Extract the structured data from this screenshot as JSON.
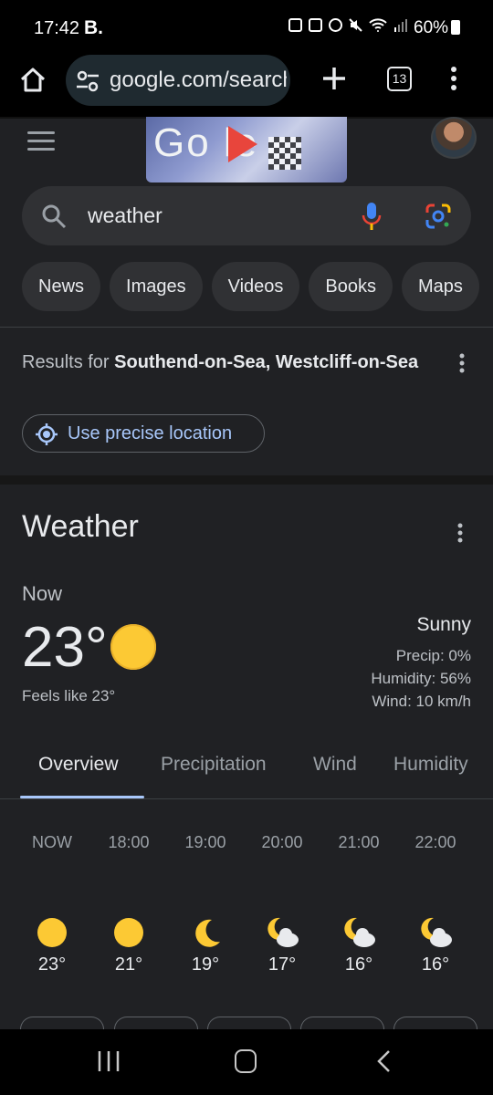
{
  "status_bar": {
    "time": "17:42",
    "brand": "B.",
    "battery": "60%"
  },
  "browser": {
    "url": "google.com/search?q=weather",
    "tab_count": "13"
  },
  "google": {
    "doodle_text": "Go  le",
    "search_query": "weather",
    "chips": [
      "News",
      "Images",
      "Videos",
      "Books",
      "Maps"
    ]
  },
  "location": {
    "prefix": "Results for ",
    "place": "Southend-on-Sea, Westcliff-on-Sea",
    "precise_button": "Use precise location"
  },
  "weather": {
    "title": "Weather",
    "now_label": "Now",
    "temperature": "23°",
    "feels_like": "Feels like 23°",
    "condition": "Sunny",
    "precip": "Precip: 0%",
    "humidity": "Humidity: 56%",
    "wind": "Wind: 10 km/h",
    "tabs": [
      "Overview",
      "Precipitation",
      "Wind",
      "Humidity"
    ],
    "hourly": [
      {
        "time": "NOW",
        "icon": "sun-icon",
        "temp": "23°"
      },
      {
        "time": "18:00",
        "icon": "sun-icon",
        "temp": "21°"
      },
      {
        "time": "19:00",
        "icon": "moon-icon",
        "temp": "19°"
      },
      {
        "time": "20:00",
        "icon": "moon-cloud-icon",
        "temp": "17°"
      },
      {
        "time": "21:00",
        "icon": "moon-cloud-icon",
        "temp": "16°"
      },
      {
        "time": "22:00",
        "icon": "moon-cloud-icon",
        "temp": "16°"
      }
    ]
  },
  "colors": {
    "accent": "#a8c7fa",
    "sun": "#fcc934",
    "background": "#202124"
  }
}
